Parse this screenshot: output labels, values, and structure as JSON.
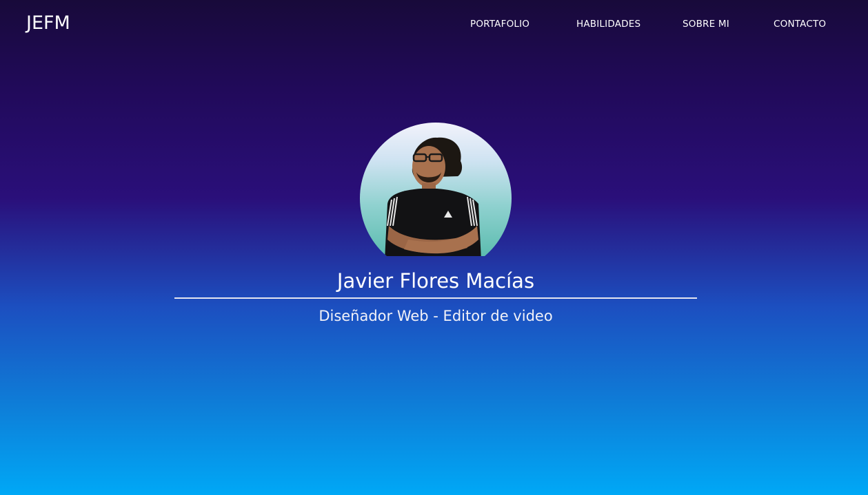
{
  "header": {
    "logo": "JEFM",
    "nav": [
      {
        "label": "PORTAFOLIO"
      },
      {
        "label": "HABILIDADES"
      },
      {
        "label": "SOBRE MI"
      },
      {
        "label": "CONTACTO"
      }
    ]
  },
  "hero": {
    "name": "Javier Flores Macías",
    "subtitle": "Diseñador Web - Editor de video",
    "avatar_icon": "profile-photo"
  },
  "colors": {
    "gradient_top": "#180a3a",
    "gradient_mid": "#2a0f7a",
    "gradient_bottom": "#00a8f6",
    "text": "#ffffff"
  }
}
